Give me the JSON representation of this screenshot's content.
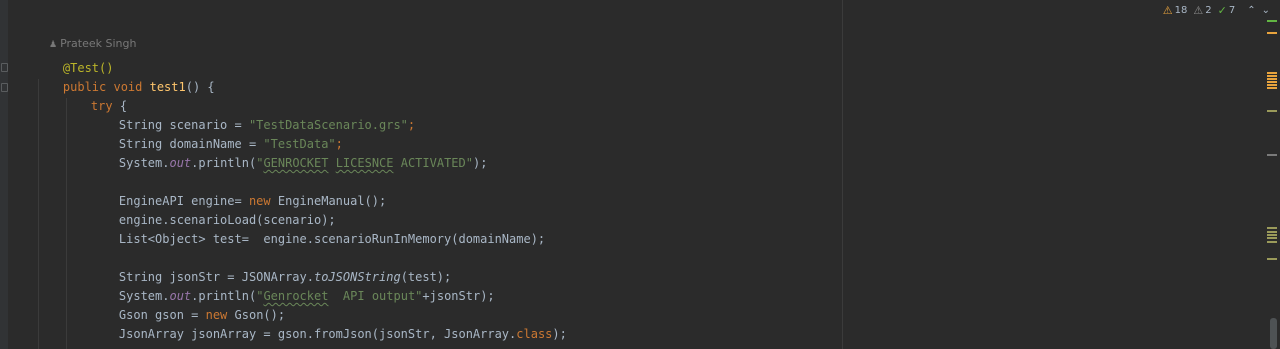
{
  "author": {
    "name": "Prateek Singh",
    "icon": "person-icon"
  },
  "inspections": {
    "warnings": "18",
    "weak_warnings": "2",
    "typos": "7",
    "warning_icon": "warning-triangle-icon",
    "weak_warning_icon": "weak-warning-triangle-icon",
    "typo_icon": "double-check-icon",
    "prev_icon": "chevron-up-icon",
    "next_icon": "chevron-down-icon"
  },
  "code": {
    "annotation": "@Test()",
    "method_sig_1": "public void ",
    "method_name": "test1",
    "method_sig_2": "() {",
    "try_kw": "try",
    "try_brace": " {",
    "l1_type": "String scenario = ",
    "l1_str": "\"TestDataScenario.grs\"",
    "l1_end": ";",
    "l2_type": "String domainName = ",
    "l2_str": "\"TestData\"",
    "l2_end": ";",
    "l3_a": "System.",
    "l3_field": "out",
    "l3_b": ".println(",
    "l3_s1": "\"",
    "l3_w1": "GENROCKET",
    "l3_s2": " ",
    "l3_w2": "LICESNCE",
    "l3_s3": " ACTIVATED\"",
    "l3_end": ");",
    "l4_a": "EngineAPI engine= ",
    "l4_kw": "new",
    "l4_b": " EngineManual();",
    "l5": "engine.scenarioLoad(scenario);",
    "l6": "List<Object> test=  engine.scenarioRunInMemory(domainName);",
    "l7_a": "String jsonStr = JSONArray.",
    "l7_m": "toJSONString",
    "l7_b": "(test);",
    "l8_a": "System.",
    "l8_field": "out",
    "l8_b": ".println(",
    "l8_s1": "\"",
    "l8_w1": "Genrocket",
    "l8_s2": "  API output\"",
    "l8_end": "+jsonStr);",
    "l9_a": "Gson gson = ",
    "l9_kw": "new",
    "l9_b": " Gson();",
    "l10_a": "JsonArray jsonArray = gson.fromJson(jsonStr, JsonArray.",
    "l10_kw": "class",
    "l10_b": ");"
  },
  "colors": {
    "background": "#2b2b2b",
    "keyword": "#cc7832",
    "annotation": "#bbb529",
    "method_decl": "#ffc66d",
    "string": "#6a8759",
    "static_field": "#9876aa",
    "warning": "#e8a33d",
    "ok": "#62b543"
  }
}
